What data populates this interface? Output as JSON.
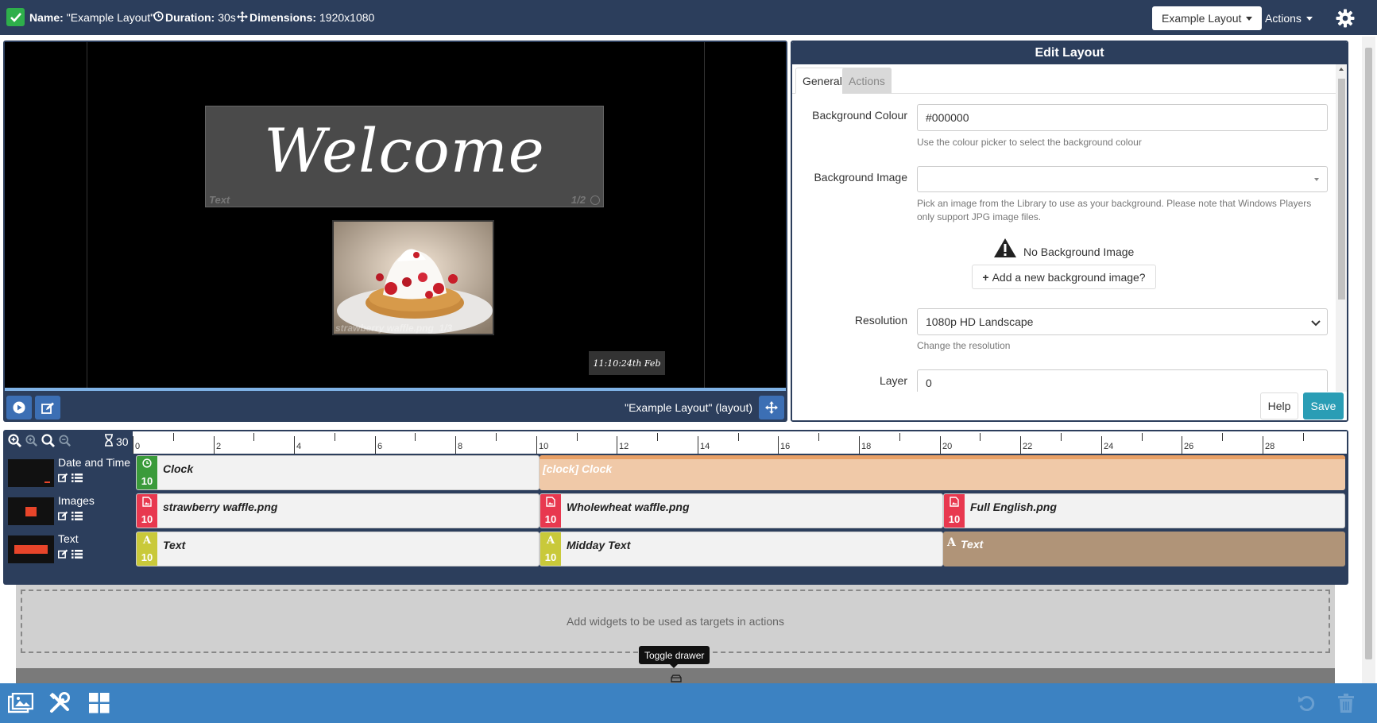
{
  "topbar": {
    "name_label": "Name:",
    "name_value": "\"Example Layout\"",
    "duration_label": "Duration:",
    "duration_value": "30s",
    "dimensions_label": "Dimensions:",
    "dimensions_value": "1920x1080",
    "layout_dropdown": "Example Layout",
    "actions_dropdown": "Actions"
  },
  "viewer": {
    "welcome_text": "Welcome",
    "welcome_region_name": "Text",
    "welcome_region_page": "1/2",
    "image_region_name": "strawberry waffle.png",
    "image_region_page": "1/3",
    "clock_text": "11:10:24th Feb",
    "layout_label": "\"Example Layout\" (layout)"
  },
  "edit_panel": {
    "title": "Edit Layout",
    "tabs": [
      "General",
      "Actions"
    ],
    "background_colour": {
      "label": "Background Colour",
      "value": "#000000",
      "help": "Use the colour picker to select the background colour"
    },
    "background_image": {
      "label": "Background Image",
      "value": "",
      "help": "Pick an image from the Library to use as your background. Please note that Windows Players only support JPG image files.",
      "empty_text": "No Background Image",
      "add_button": "Add a new background image?"
    },
    "resolution": {
      "label": "Resolution",
      "value": "1080p HD Landscape",
      "help": "Change the resolution"
    },
    "layer": {
      "label": "Layer",
      "value": "0"
    },
    "help_button": "Help",
    "save_button": "Save"
  },
  "timeline": {
    "duration_readout": "30",
    "ruler_labels": [
      "0",
      "2",
      "4",
      "6",
      "8",
      "10",
      "12",
      "14",
      "16",
      "18",
      "20",
      "22",
      "24",
      "26",
      "28"
    ],
    "rows": [
      {
        "name": "Date and Time",
        "widgets": [
          {
            "name": "Clock",
            "duration": "10",
            "type": "clock",
            "color": "#3a9b3a"
          },
          {
            "name": "[clock] Clock",
            "type": "loop",
            "color": "#f0c9a8"
          }
        ]
      },
      {
        "name": "Images",
        "widgets": [
          {
            "name": "strawberry waffle.png",
            "duration": "10",
            "type": "image",
            "color": "#e8384f"
          },
          {
            "name": "Wholewheat waffle.png",
            "duration": "10",
            "type": "image",
            "color": "#e8384f"
          },
          {
            "name": "Full English.png",
            "duration": "10",
            "type": "image",
            "color": "#e8384f"
          }
        ]
      },
      {
        "name": "Text",
        "widgets": [
          {
            "name": "Text",
            "duration": "10",
            "type": "text",
            "color": "#c9c93a"
          },
          {
            "name": "Midday Text",
            "duration": "10",
            "type": "text",
            "color": "#c9c93a"
          },
          {
            "name": "Text",
            "type": "loop",
            "color": "#b09478"
          }
        ]
      }
    ]
  },
  "drawer": {
    "placeholder": "Add widgets to be used as targets in actions",
    "tooltip": "Toggle drawer"
  },
  "colors": {
    "navy": "#2c3e5c",
    "accent_blue": "#3c82c2",
    "save_teal": "#2a9db5",
    "success_green": "#2eaf4b"
  }
}
